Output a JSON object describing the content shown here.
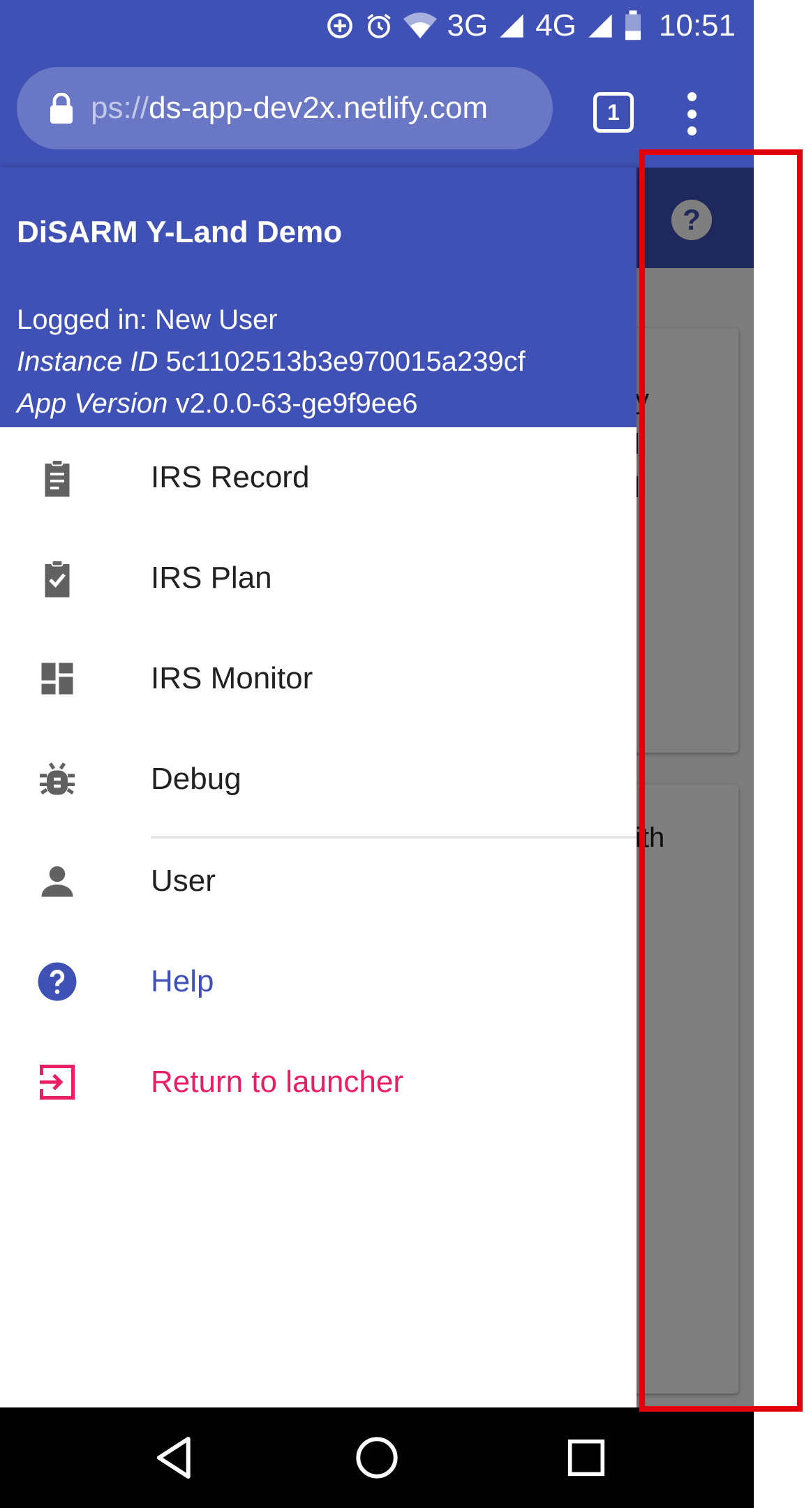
{
  "status_bar": {
    "network_1": "3G",
    "network_2": "4G",
    "time": "10:51"
  },
  "url_bar": {
    "url_scheme": "ps://",
    "url_host": "ds-app-dev2x.netlify.com",
    "tab_count": "1"
  },
  "background_app": {
    "card2_fragment": "ith",
    "help_icon": "help-circle-icon"
  },
  "drawer": {
    "title": "DiSARM Y-Land Demo",
    "logged_in": "Logged in: New User",
    "instance_label": "Instance ID",
    "instance_value": "5c1102513b3e970015a239cf",
    "version_label": "App Version",
    "version_value": "v2.0.0-63-ge9f9ee6",
    "items": [
      {
        "label": "IRS Record",
        "icon": "clipboard-icon",
        "color": "#212121"
      },
      {
        "label": "IRS Plan",
        "icon": "clipboard-check-icon",
        "color": "#212121"
      },
      {
        "label": "IRS Monitor",
        "icon": "dashboard-icon",
        "color": "#212121"
      },
      {
        "label": "Debug",
        "icon": "bug-icon",
        "color": "#212121"
      },
      {
        "label": "User",
        "icon": "person-icon",
        "color": "#212121"
      },
      {
        "label": "Help",
        "icon": "help-circle-icon",
        "color": "#3f51b5"
      },
      {
        "label": "Return to launcher",
        "icon": "exit-icon",
        "color": "#e91e63"
      }
    ]
  },
  "colors": {
    "primary": "#3f51b5",
    "accent_return": "#e91e63",
    "highlight": "#e0000a",
    "icon_grey": "#616161"
  }
}
